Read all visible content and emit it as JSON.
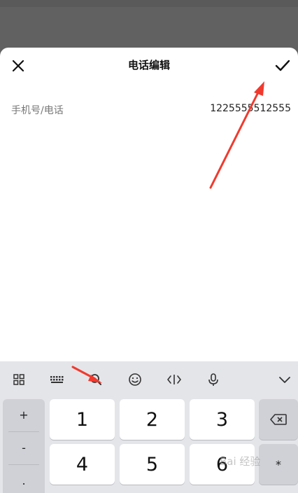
{
  "header": {
    "title": "电话编辑",
    "close_icon": "close-icon",
    "confirm_icon": "checkmark-icon"
  },
  "field": {
    "label": "手机号/电话",
    "value": "1225555512555"
  },
  "keyboard": {
    "toolbar_icons": [
      "grid-icon",
      "keyboard-icon",
      "search-icon",
      "emoji-icon",
      "cursor-icon",
      "microphone-icon",
      "chevron-down-icon"
    ],
    "side_keys": [
      "+",
      "-",
      "."
    ],
    "row1": [
      "1",
      "2",
      "3"
    ],
    "row2": [
      "4",
      "5",
      "6"
    ],
    "delete_icon": "backspace-icon",
    "star": "*"
  },
  "watermark": "Bai 经验",
  "annotation_color": "#f03a2e"
}
